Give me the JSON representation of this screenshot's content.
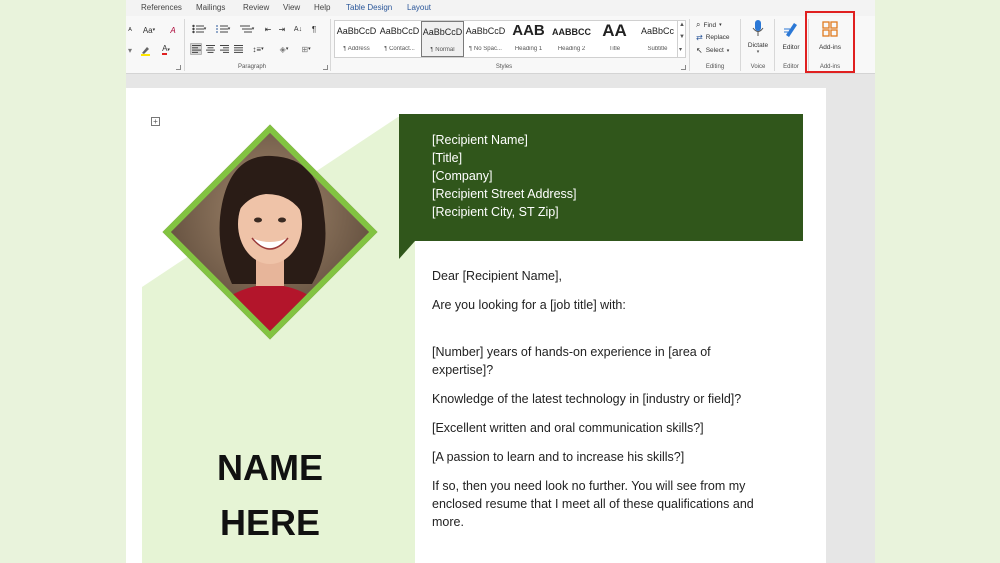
{
  "ribbon": {
    "tabs": [
      "References",
      "Mailings",
      "Review",
      "View",
      "Help",
      "Table Design",
      "Layout"
    ],
    "font_size_label": "Aa",
    "font_color_label": "A",
    "paragraph_group": "Paragraph",
    "styles_group": "Styles",
    "editing_group": "Editing",
    "voice_group": "Voice",
    "editor_group": "Editor",
    "addins_group": "Add-ins",
    "styles": [
      {
        "sample": "AaBbCcD",
        "name": "¶ Address"
      },
      {
        "sample": "AaBbCcD",
        "name": "¶ Contact..."
      },
      {
        "sample": "AaBbCcD",
        "name": "¶ Normal"
      },
      {
        "sample": "AaBbCcD",
        "name": "¶ No Spac..."
      },
      {
        "sample": "AAB",
        "name": "Heading 1"
      },
      {
        "sample": "AABBCC",
        "name": "Heading 2"
      },
      {
        "sample": "AA",
        "name": "Title"
      },
      {
        "sample": "AaBbCc",
        "name": "Subtitle"
      }
    ],
    "find_label": "Find",
    "replace_label": "Replace",
    "select_label": "Select",
    "dictate_label": "Dictate",
    "editor_label": "Editor",
    "addins_label": "Add-ins",
    "accent_color": "#2b579a",
    "highlight_color": "#e02020"
  },
  "document": {
    "address_lines": [
      "[Recipient Name]",
      "[Title]",
      "[Company]",
      "[Recipient Street Address]",
      "[Recipient City, ST Zip]"
    ],
    "name_line1": "NAME",
    "name_line2": "HERE",
    "greeting": "Dear [Recipient Name],",
    "intro": "Are you looking for a [job title] with:",
    "bullets": [
      "[Number] years of hands-on experience in [area of expertise]?",
      "Knowledge of the latest technology in [industry or field]?",
      "[Excellent written and oral communication skills?]",
      "[A passion to learn and to increase his skills?]"
    ],
    "closing": "If so, then you need look no further. You will see from my enclosed resume that I meet all of these qualifications and more.",
    "header_color": "#30561b",
    "panel_color": "#e6f4d5",
    "frame_color": "#82c341"
  }
}
